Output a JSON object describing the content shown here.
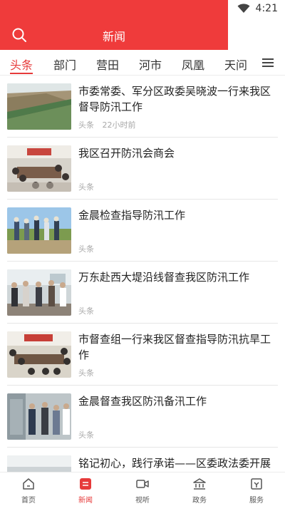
{
  "status": {
    "time": "4:21",
    "wifi_icon": "wifi-icon"
  },
  "header": {
    "title": "新闻",
    "search_icon": "search-icon"
  },
  "tabs": [
    {
      "label": "头条",
      "active": true
    },
    {
      "label": "部门"
    },
    {
      "label": "营田"
    },
    {
      "label": "河市"
    },
    {
      "label": "凤凰"
    },
    {
      "label": "天问"
    }
  ],
  "menu_icon": "menu-icon",
  "articles": [
    {
      "title": "市委常委、军分区政委吴晓波一行来我区督导防汛工作",
      "tag": "头条",
      "time": "22小时前"
    },
    {
      "title": "我区召开防汛会商会",
      "tag": "头条"
    },
    {
      "title": "金晨检查指导防汛工作",
      "tag": "头条"
    },
    {
      "title": "万东赴西大堤沿线督查我区防汛工作",
      "tag": "头条"
    },
    {
      "title": "市督查组一行来我区督查指导防汛抗旱工作",
      "tag": "头条"
    },
    {
      "title": "金晨督查我区防汛备汛工作",
      "tag": "头条"
    },
    {
      "title": "铭记初心，践行承诺——区委政法委开展",
      "tag": "头条"
    }
  ],
  "bottom_nav": [
    {
      "label": "首页",
      "icon": "home-icon"
    },
    {
      "label": "新闻",
      "icon": "news-icon",
      "active": true
    },
    {
      "label": "视听",
      "icon": "video-icon"
    },
    {
      "label": "政务",
      "icon": "government-icon"
    },
    {
      "label": "服务",
      "icon": "service-icon"
    }
  ],
  "colors": {
    "accent": "#e63a3a",
    "header_bg": "#ef3b3b"
  }
}
